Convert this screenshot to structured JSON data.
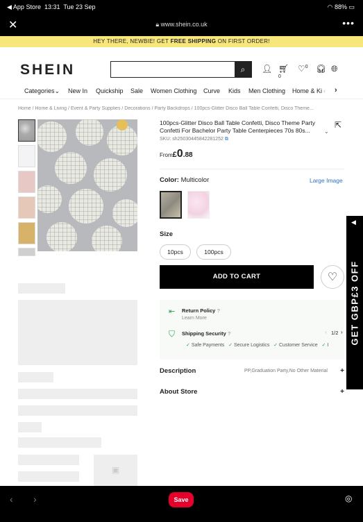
{
  "status_bar": {
    "carrier": "◀ App Store",
    "time": "13:31",
    "date": "Tue 23 Sep",
    "battery": "88%"
  },
  "browser": {
    "url": "www.shein.co.uk"
  },
  "promo": {
    "prefix": "HEY THERE, NEWBIE! GET ",
    "highlight": "FREE SHIPPING",
    "suffix": " ON FIRST ORDER!"
  },
  "header": {
    "logo": "SHEIN",
    "cart_count": "0",
    "wish_count": "0",
    "search_placeholder": ""
  },
  "nav": {
    "items": [
      "Categories",
      "New In",
      "Quickship",
      "Sale",
      "Women Clothing",
      "Curve",
      "Kids",
      "Men Clothing",
      "Home & Ki"
    ]
  },
  "breadcrumb": "Home / Home & Living / Event & Party Supplies / Decorations / Party Backdrops / 100pcs-Glitter Disco Ball Table Confetti, Disco Theme...",
  "product": {
    "title": "100pcs-Glitter Disco Ball Table Confetti, Disco Theme Party Confetti For Bachelor Party Table Centerpieces 70s 80s...",
    "sku": "SKU: sh2503044584228125​2",
    "price_prefix": "From",
    "currency": "£",
    "price_int": "0",
    "price_dec": ".88",
    "color_label": "Color:",
    "color_value": "Multicolor",
    "large_image": "Large Image",
    "size_label": "Size",
    "sizes": [
      "10pcs",
      "100pcs"
    ],
    "add_to_cart": "ADD TO CART"
  },
  "policy": {
    "return_title": "Return Policy",
    "return_sub": "Learn More",
    "security_title": "Shipping Security",
    "pager": "1/2",
    "checks": [
      "Safe Payments",
      "Secure Logistics",
      "Customer Service",
      "I"
    ]
  },
  "sections": {
    "description": "Description",
    "description_extra": "PP,Graduation Party,No Other Material",
    "about_store": "About Store"
  },
  "side_promo": "GET GBP£3 OFF",
  "bottom": {
    "save": "Save"
  },
  "colors": {
    "promo_bg": "#f7e67a",
    "link": "#2f73c4",
    "save": "#e4002b",
    "check": "#2a9d4a"
  }
}
